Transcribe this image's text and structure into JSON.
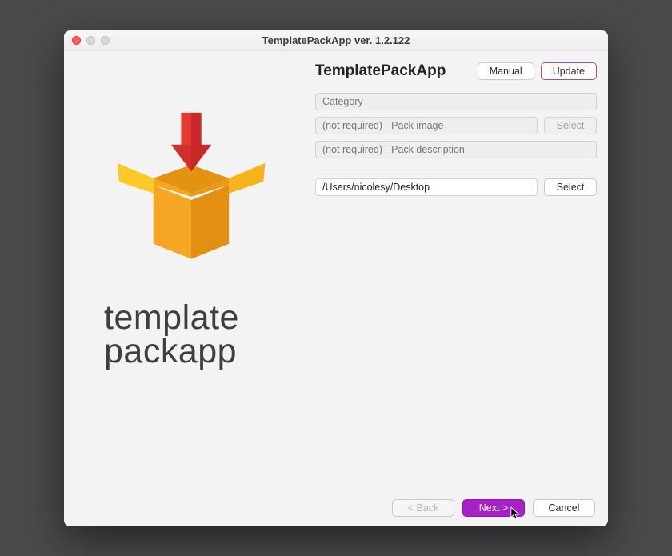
{
  "window": {
    "title": "TemplatePackApp ver. 1.2.122"
  },
  "branding": {
    "header": "TemplatePackApp",
    "logo_line1": "template",
    "logo_line2": "packapp"
  },
  "header_buttons": {
    "manual": "Manual",
    "update": "Update"
  },
  "fields": {
    "category_placeholder": "Category",
    "pack_image_placeholder": "(not required) - Pack image",
    "pack_image_select": "Select",
    "pack_desc_placeholder": "(not required) - Pack description",
    "output_path_value": "/Users/nicolesy/Desktop",
    "output_path_select": "Select"
  },
  "footer": {
    "back": "< Back",
    "next": "Next >",
    "cancel": "Cancel"
  }
}
